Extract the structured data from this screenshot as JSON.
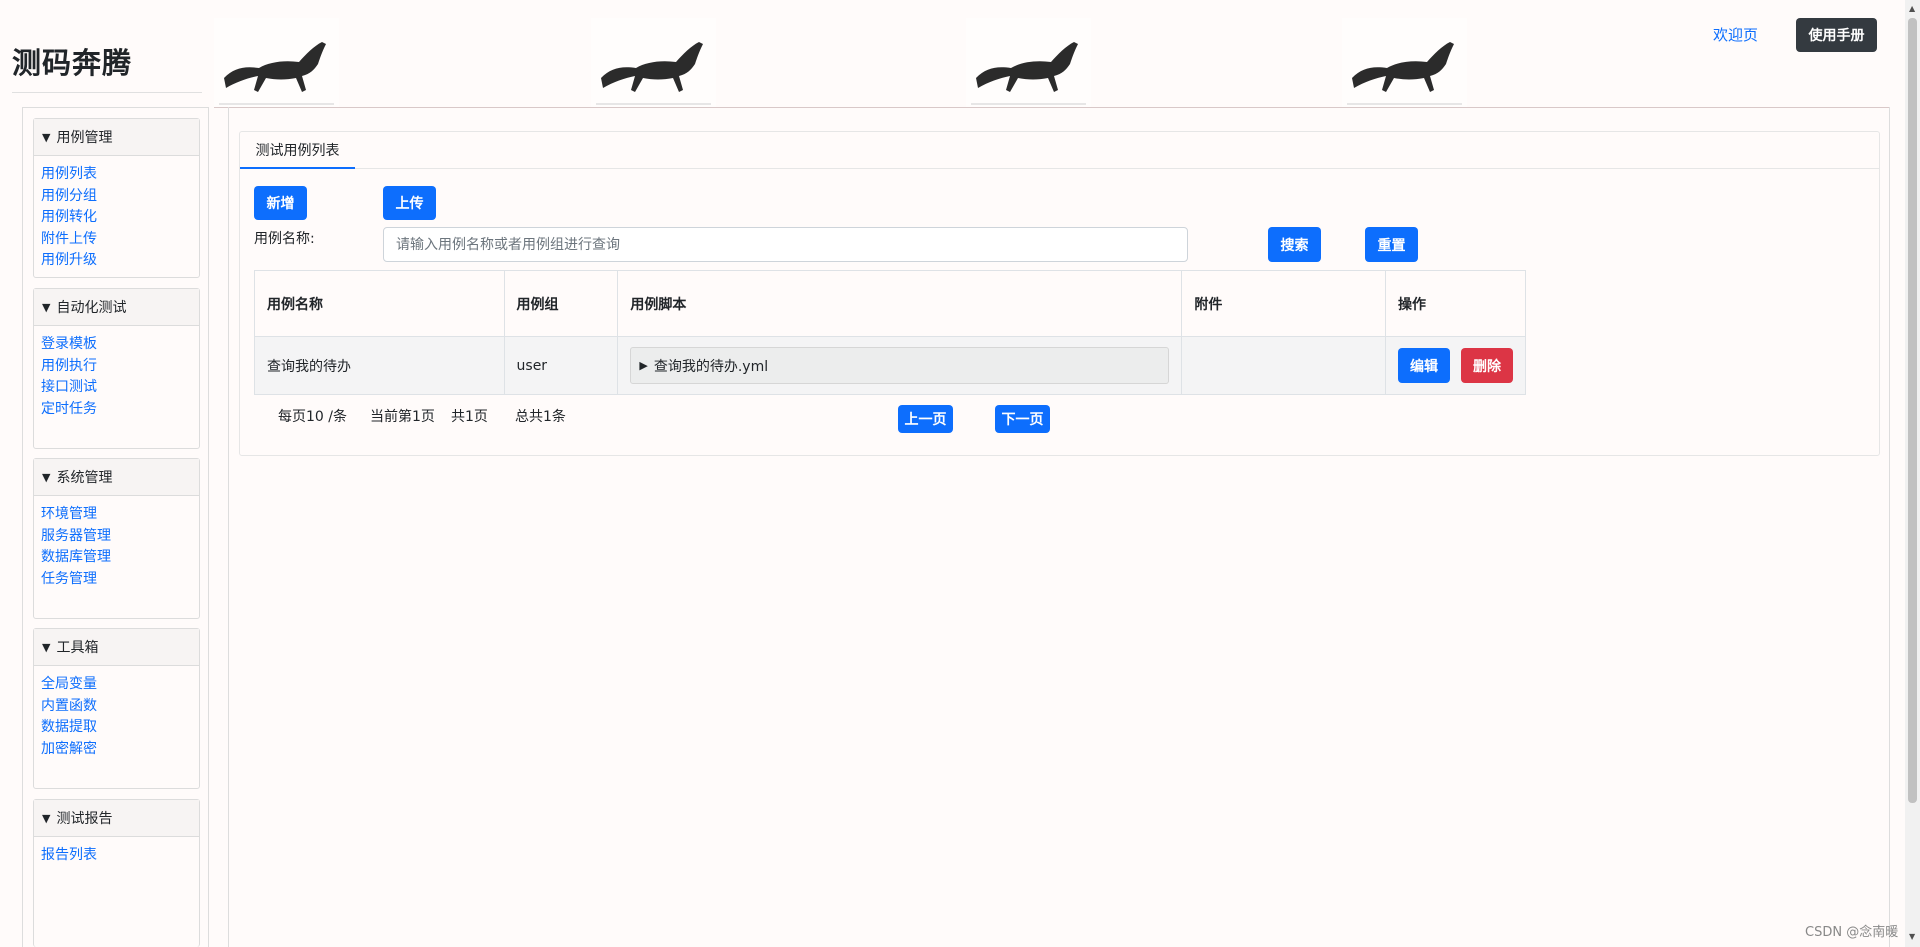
{
  "header": {
    "brand": "测码奔腾",
    "welcome_link": "欢迎页",
    "manual_button": "使用手册"
  },
  "sidebar": {
    "groups": [
      {
        "title": "用例管理",
        "items": [
          "用例列表",
          "用例分组",
          "用例转化",
          "附件上传",
          "用例升级"
        ]
      },
      {
        "title": "自动化测试",
        "items": [
          "登录模板",
          "用例执行",
          "接口测试",
          "定时任务"
        ]
      },
      {
        "title": "系统管理",
        "items": [
          "环境管理",
          "服务器管理",
          "数据库管理",
          "任务管理"
        ]
      },
      {
        "title": "工具箱",
        "items": [
          "全局变量",
          "内置函数",
          "数据提取",
          "加密解密"
        ]
      },
      {
        "title": "测试报告",
        "items": [
          "报告列表"
        ]
      }
    ]
  },
  "main": {
    "tab_label": "测试用例列表",
    "add_button": "新增",
    "upload_button": "上传",
    "search_label": "用例名称:",
    "search_placeholder": "请输入用例名称或者用例组进行查询",
    "search_button": "搜索",
    "reset_button": "重置",
    "table": {
      "headers": [
        "用例名称",
        "用例组",
        "用例脚本",
        "附件",
        "操作"
      ],
      "rows": [
        {
          "name": "查询我的待办",
          "group": "user",
          "script": "查询我的待办.yml",
          "attachment": "",
          "edit": "编辑",
          "delete": "删除"
        }
      ]
    },
    "pager": {
      "per_page": "每页10 /条",
      "current": "当前第1页",
      "total_pages": "共1页",
      "total_items": "总共1条",
      "prev": "上一页",
      "next": "下一页"
    }
  },
  "watermark": "CSDN @念南暖",
  "colors": {
    "primary": "#0d6efd",
    "danger": "#dc3545",
    "dark": "#343a40",
    "page_background": "#fffbfa"
  },
  "icons": {
    "banner_image": "horse-image",
    "group_toggle": "triangle-down-icon",
    "script_toggle": "triangle-right-icon"
  }
}
